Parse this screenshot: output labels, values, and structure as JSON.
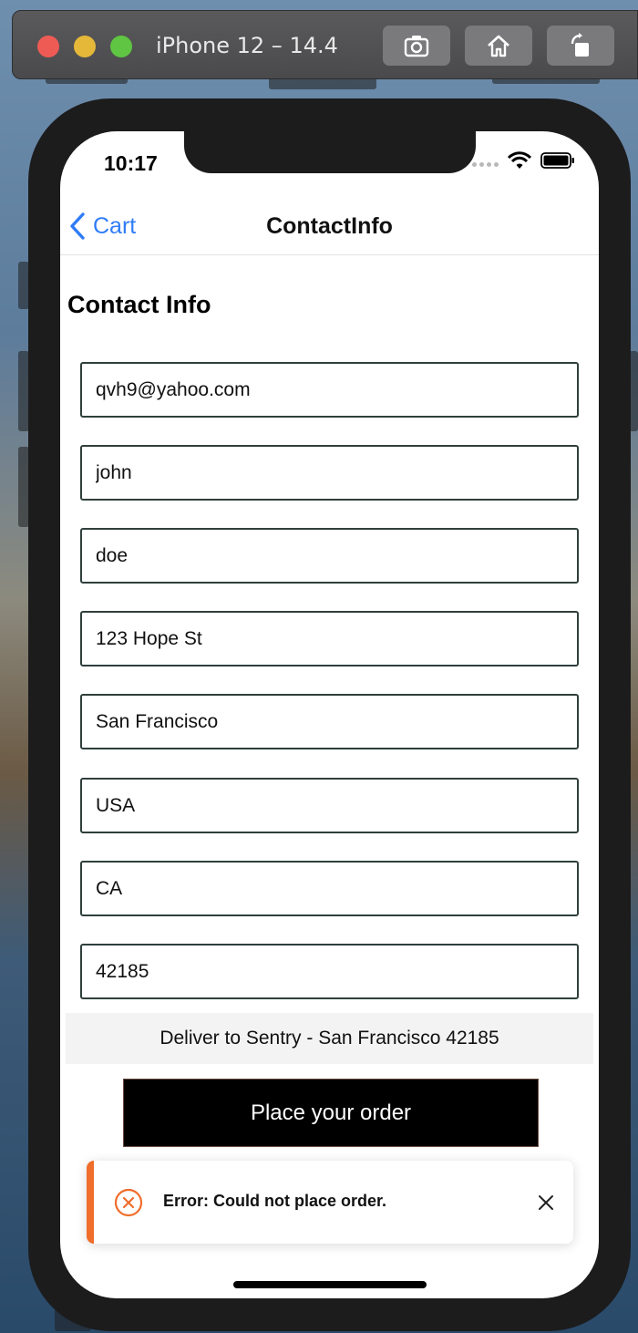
{
  "simulator": {
    "title": "iPhone 12 – 14.4",
    "buttons": [
      "screenshot-icon",
      "home-icon",
      "rotate-icon"
    ]
  },
  "status_bar": {
    "time": "10:17"
  },
  "navbar": {
    "back_label": "Cart",
    "title": "ContactInfo"
  },
  "heading": "Contact Info",
  "fields": [
    {
      "name": "email",
      "value": "qvh9@yahoo.com"
    },
    {
      "name": "first-name",
      "value": "john"
    },
    {
      "name": "last-name",
      "value": "doe"
    },
    {
      "name": "address",
      "value": "123 Hope St"
    },
    {
      "name": "city",
      "value": "San Francisco"
    },
    {
      "name": "country",
      "value": "USA"
    },
    {
      "name": "state",
      "value": "CA"
    },
    {
      "name": "zip",
      "value": "42185"
    }
  ],
  "delivery_text": "Deliver to Sentry - San Francisco 42185",
  "order_button_label": "Place your order",
  "toast": {
    "message": "Error: Could not place order.",
    "accent_color": "#f06d2b"
  },
  "colors": {
    "link": "#2f7cf6",
    "button_bg": "#000000",
    "error": "#f06d2b"
  }
}
